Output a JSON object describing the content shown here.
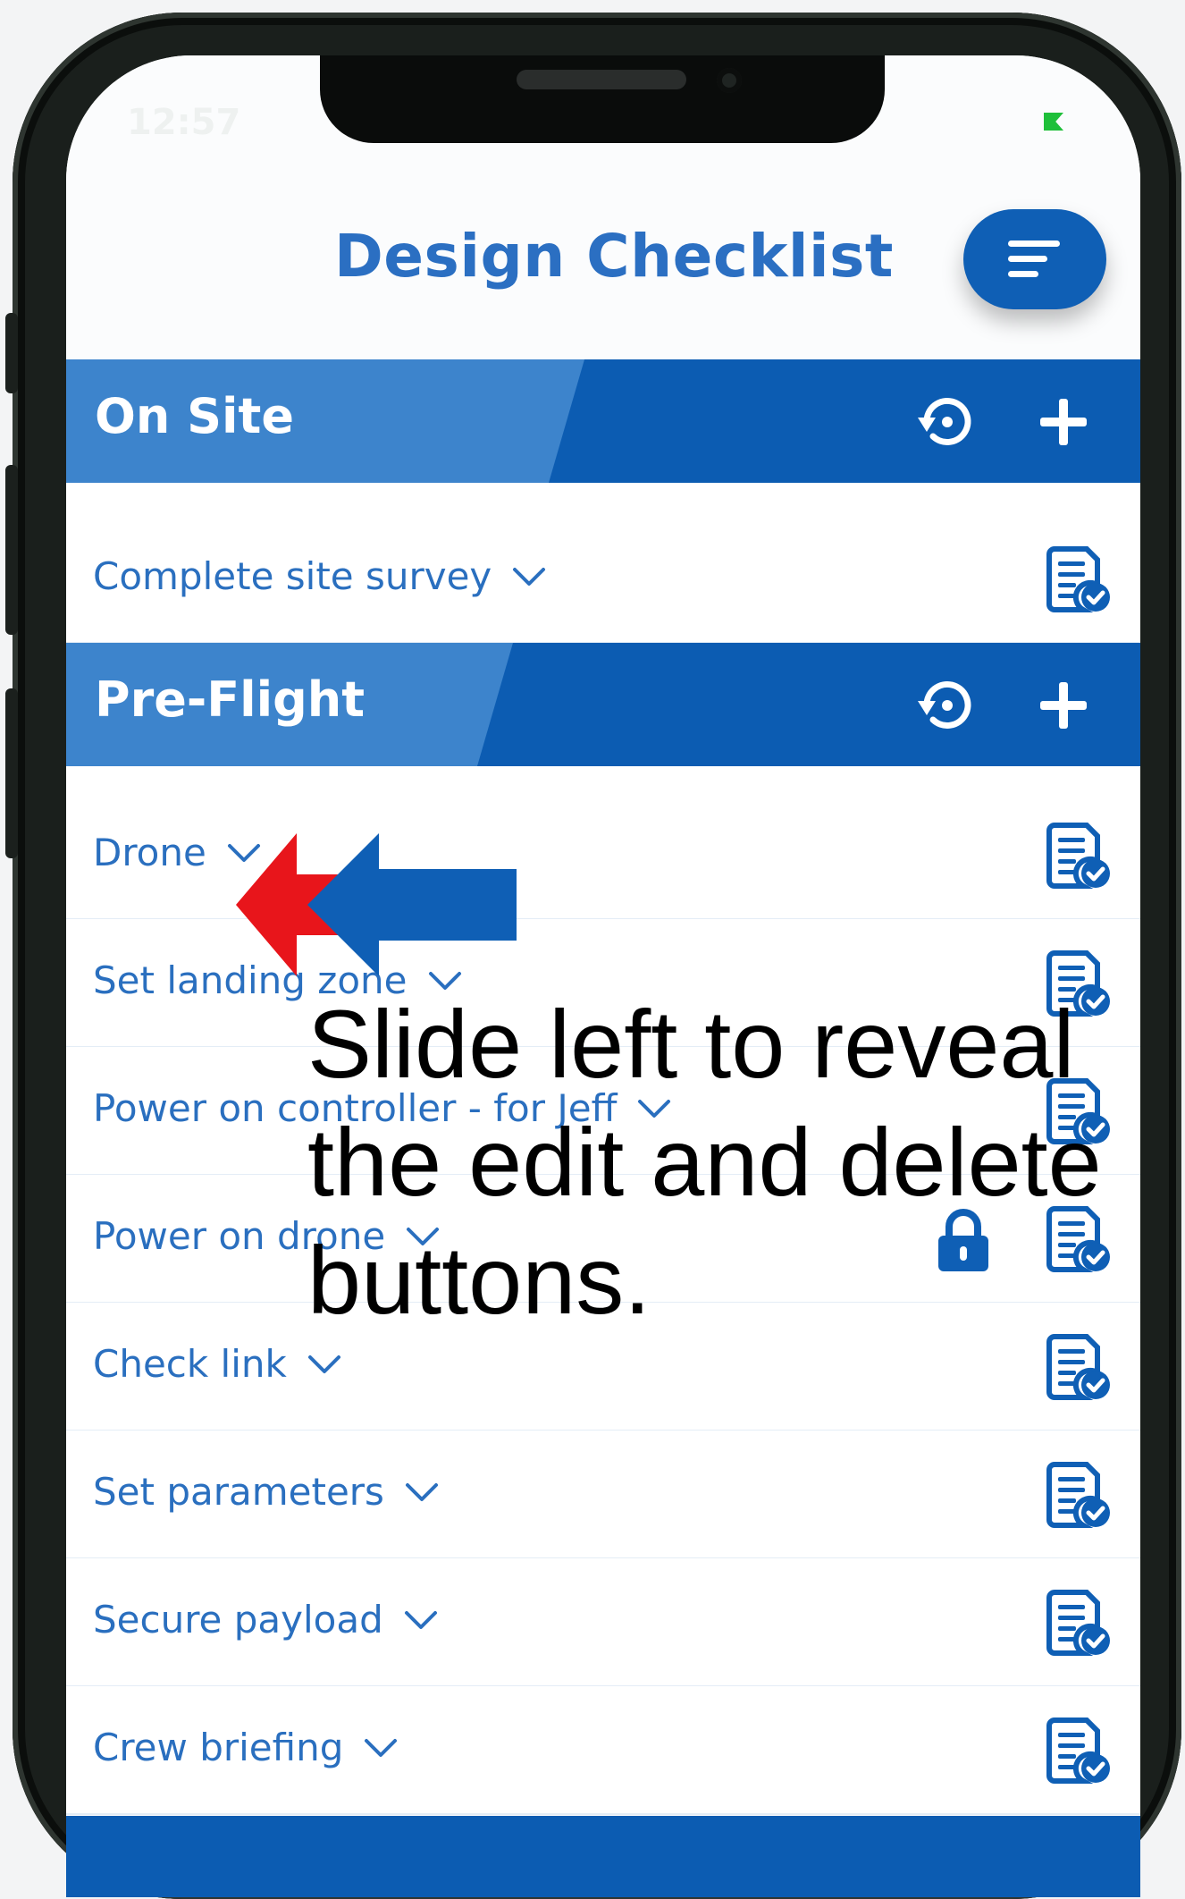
{
  "app": {
    "title": "Design Checklist",
    "status_time": "12:57"
  },
  "colors": {
    "primary": "#0c5cb2",
    "band": "#3d84cc",
    "text_blue": "#2a6fbf",
    "arrow_red": "#e8151b",
    "arrow_blue": "#0f5fb5"
  },
  "icons": {
    "menu": "menu-lines-icon",
    "reset": "history-icon",
    "add": "plus-icon",
    "item": "checklist-doc-icon",
    "lock": "lock-icon",
    "expand": "chevron-down-icon"
  },
  "sections": [
    {
      "label": "On Site",
      "items": [
        {
          "label": "Complete site survey",
          "locked": false
        }
      ]
    },
    {
      "label": "Pre-Flight",
      "items": [
        {
          "label": "Drone",
          "locked": false
        },
        {
          "label": "Set landing zone",
          "locked": false
        },
        {
          "label": "Power on controller - for Jeff",
          "locked": false
        },
        {
          "label": "Power on drone",
          "locked": true
        },
        {
          "label": "Check link",
          "locked": false
        },
        {
          "label": "Set parameters",
          "locked": false
        },
        {
          "label": "Secure payload",
          "locked": false
        },
        {
          "label": "Crew briefing",
          "locked": false
        }
      ]
    }
  ],
  "tutorial": {
    "message": "Slide left to reveal the edit and delete buttons."
  }
}
